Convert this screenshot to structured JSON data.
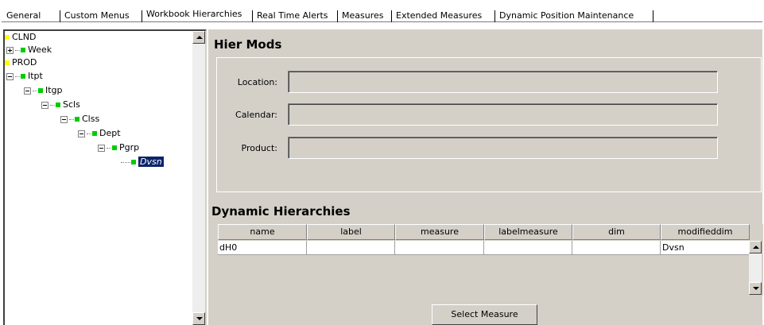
{
  "tabs": [
    {
      "label": "General"
    },
    {
      "label": "Custom Menus"
    },
    {
      "label": "Workbook Hierarchies"
    },
    {
      "label": "Real Time Alerts"
    },
    {
      "label": "Measures"
    },
    {
      "label": "Extended Measures"
    },
    {
      "label": "Dynamic Position Maintenance"
    }
  ],
  "active_tab": "Workbook Hierarchies",
  "tree": [
    {
      "label": "CLND",
      "color": "yellow",
      "expander": "none"
    },
    {
      "label": "Week",
      "color": "green",
      "expander": "plus"
    },
    {
      "label": "PROD",
      "color": "yellow",
      "expander": "none"
    },
    {
      "label": "Itpt",
      "color": "green",
      "expander": "minus"
    },
    {
      "label": "Itgp",
      "color": "green",
      "expander": "minus"
    },
    {
      "label": "Scls",
      "color": "green",
      "expander": "minus"
    },
    {
      "label": "Clss",
      "color": "green",
      "expander": "minus"
    },
    {
      "label": "Dept",
      "color": "green",
      "expander": "minus"
    },
    {
      "label": "Pgrp",
      "color": "green",
      "expander": "minus"
    },
    {
      "label": "Dvsn",
      "color": "green",
      "expander": "none",
      "selected": true
    }
  ],
  "hier_mods": {
    "title": "Hier Mods",
    "location_label": "Location:",
    "location_value": "",
    "calendar_label": "Calendar:",
    "calendar_value": "",
    "product_label": "Product:",
    "product_value": ""
  },
  "dynamic": {
    "title": "Dynamic Hierarchies",
    "columns": [
      "name",
      "label",
      "measure",
      "labelmeasure",
      "dim",
      "modifieddim"
    ],
    "rows": [
      [
        "dH0",
        "",
        "",
        "",
        "",
        "Dvsn"
      ]
    ]
  },
  "select_button": "Select Measure",
  "colors": {
    "panel": "#d4d0c8",
    "selection": "#0a246a",
    "node_green": "#00cc00",
    "node_yellow": "#ffff00"
  }
}
